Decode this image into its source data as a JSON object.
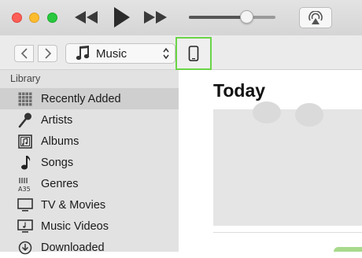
{
  "toolbar": {
    "playback": {
      "rewind": "rewind-icon",
      "play": "play-icon",
      "forward": "fast-forward-icon"
    },
    "volume_level": 0.67,
    "airplay_icon": "airplay-icon"
  },
  "navbar": {
    "back_icon": "chevron-left-icon",
    "forward_icon": "chevron-right-icon",
    "media_select": {
      "label": "Music",
      "icon": "music-note-icon"
    },
    "device_icon": "iphone-icon"
  },
  "sidebar": {
    "heading": "Library",
    "items": [
      {
        "label": "Recently Added",
        "icon": "grid-icon",
        "selected": true
      },
      {
        "label": "Artists",
        "icon": "microphone-icon"
      },
      {
        "label": "Albums",
        "icon": "album-icon"
      },
      {
        "label": "Songs",
        "icon": "music-note-icon"
      },
      {
        "label": "Genres",
        "icon": "genres-icon"
      },
      {
        "label": "TV & Movies",
        "icon": "tv-icon"
      },
      {
        "label": "Music Videos",
        "icon": "music-video-icon"
      },
      {
        "label": "Downloaded",
        "icon": "download-icon"
      }
    ]
  },
  "main": {
    "title": "Today"
  },
  "colors": {
    "highlight": "#6ad447",
    "sidebar_bg": "#e2e2e2",
    "selected_bg": "#cfcfcf"
  }
}
